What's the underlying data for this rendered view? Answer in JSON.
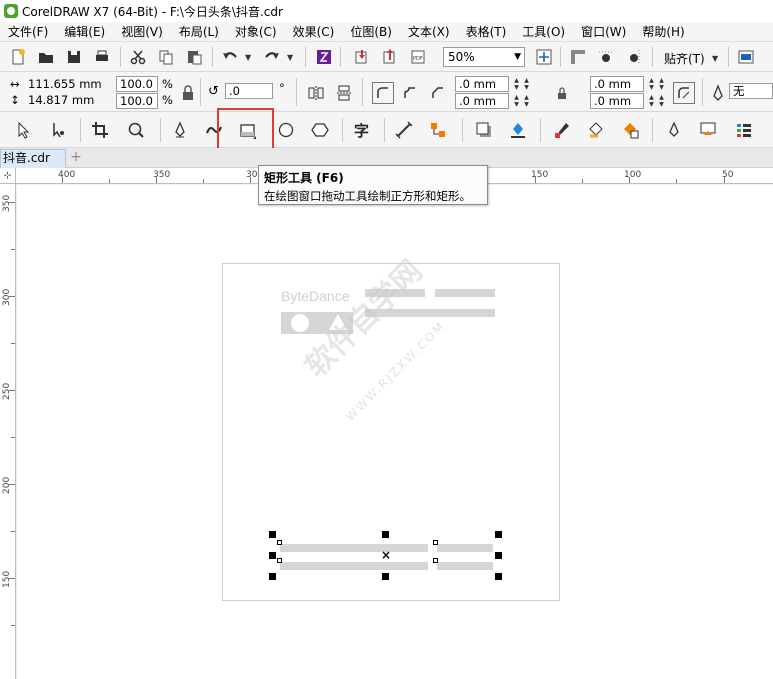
{
  "window": {
    "title": "CorelDRAW X7 (64-Bit) - F:\\今日头条\\抖音.cdr"
  },
  "menu": [
    "文件(F)",
    "编辑(E)",
    "视图(V)",
    "布局(L)",
    "对象(C)",
    "效果(C)",
    "位图(B)",
    "文本(X)",
    "表格(T)",
    "工具(O)",
    "窗口(W)",
    "帮助(H)"
  ],
  "standard_toolbar": {
    "zoom_value": "50%",
    "snap_label": "贴齐(T)"
  },
  "property_bar": {
    "x_size": "111.655 mm",
    "y_size": "14.817 mm",
    "scale_x": "100.0",
    "scale_y": "100.0",
    "percent_symbol": "%",
    "rotation": ".0",
    "degree_symbol": "°",
    "outline_1": ".0 mm",
    "outline_2": ".0 mm",
    "corner_1": ".0 mm",
    "corner_2": ".0 mm",
    "wrap_value": "无"
  },
  "document": {
    "tab_label": "抖音.cdr",
    "add_tab": "+"
  },
  "ruler": {
    "top_labels": [
      "400",
      "350",
      "300",
      "150",
      "100",
      "50"
    ],
    "left_labels": [
      "350",
      "300",
      "250",
      "200",
      "150"
    ]
  },
  "tooltip": {
    "title": "矩形工具 (F6)",
    "description": "在绘图窗口拖动工具绘制正方形和矩形。"
  },
  "logo": {
    "text": "ByteDance"
  },
  "watermark": {
    "text": "软件自学网",
    "url": "WWW.RJZXW.COM"
  },
  "colors": {
    "active_tool_highlight": "#e53935",
    "placeholder_gray": "#d6d6d6",
    "tab_bg": "#dce9f6"
  }
}
